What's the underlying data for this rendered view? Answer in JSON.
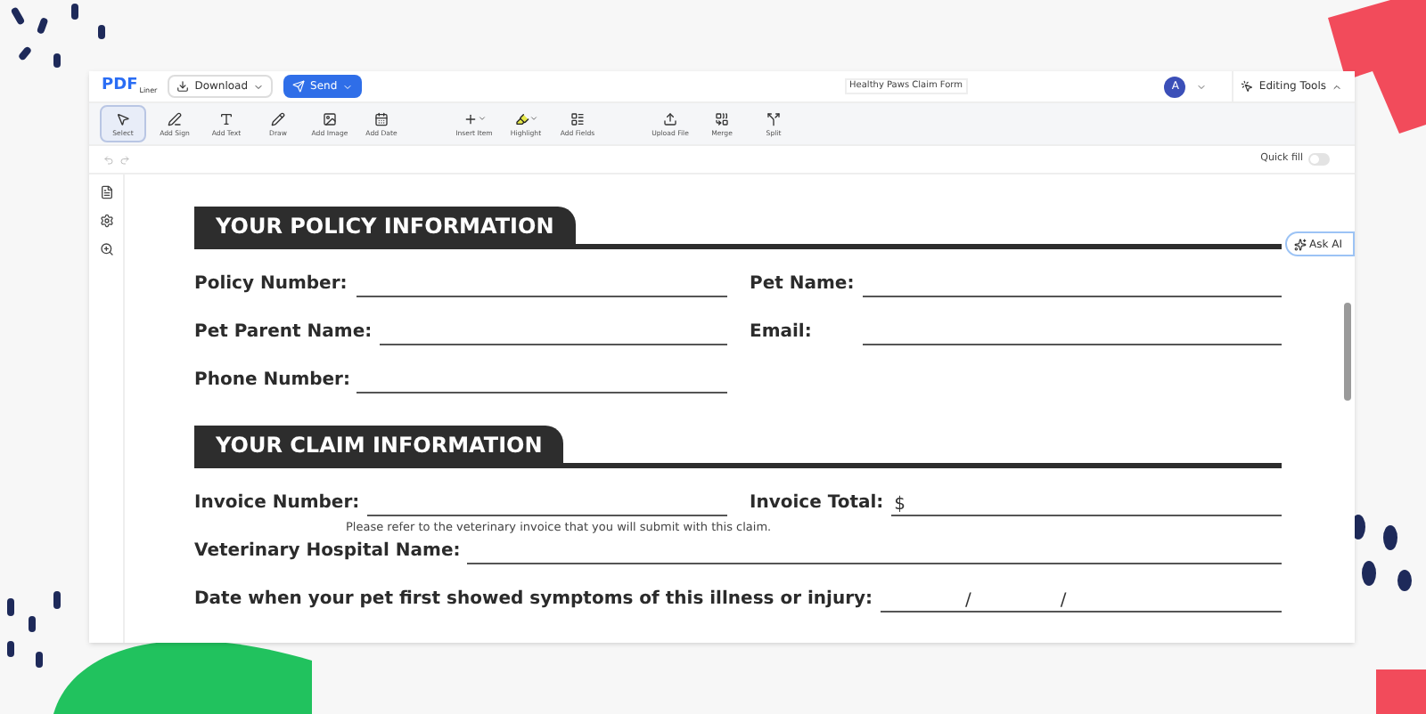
{
  "topbar": {
    "logo": "PDF",
    "logo_sub": "Liner",
    "download": "Download",
    "send": "Send",
    "document_title": "Healthy Paws Claim Form",
    "avatar": "A",
    "editing_tools": "Editing Tools"
  },
  "tools": [
    {
      "label": "Select",
      "selected": true
    },
    {
      "label": "Add Sign",
      "selected": false
    },
    {
      "label": "Add Text",
      "selected": false
    },
    {
      "label": "Draw",
      "selected": false
    },
    {
      "label": "Add Image",
      "selected": false
    },
    {
      "label": "Add Date",
      "selected": false
    },
    {
      "label": "Insert Item",
      "selected": false
    },
    {
      "label": "Highlight",
      "selected": false
    },
    {
      "label": "Add Fields",
      "selected": false
    },
    {
      "label": "Upload File",
      "selected": false
    },
    {
      "label": "Merge",
      "selected": false
    },
    {
      "label": "Split",
      "selected": false
    }
  ],
  "quick_fill": {
    "label": "Quick fill",
    "on": false
  },
  "ask_ai": "Ask AI",
  "sections": [
    {
      "title": "YOUR POLICY INFORMATION",
      "rows": [
        {
          "kind": "pair",
          "fields": [
            {
              "label": "Policy Number:"
            },
            {
              "label": "Pet Name:"
            }
          ]
        },
        {
          "kind": "pair",
          "fields": [
            {
              "label": "Pet Parent Name:"
            },
            {
              "label": "Email:"
            }
          ]
        },
        {
          "kind": "pair",
          "fields": [
            {
              "label": "Phone Number:"
            }
          ]
        }
      ]
    },
    {
      "title": "YOUR CLAIM INFORMATION",
      "rows": [
        {
          "kind": "pair",
          "fields": [
            {
              "label": "Invoice Number:",
              "note": "Please refer to the veterinary invoice that you will submit with this claim."
            },
            {
              "label": "Invoice Total:",
              "prefix": "$"
            }
          ]
        },
        {
          "kind": "single",
          "fields": [
            {
              "label": "Veterinary Hospital Name:"
            }
          ]
        },
        {
          "kind": "date",
          "fields": [
            {
              "label": "Date when your pet first showed symptoms of this illness or injury:",
              "separators": [
                "/",
                "/"
              ]
            }
          ]
        }
      ]
    }
  ]
}
